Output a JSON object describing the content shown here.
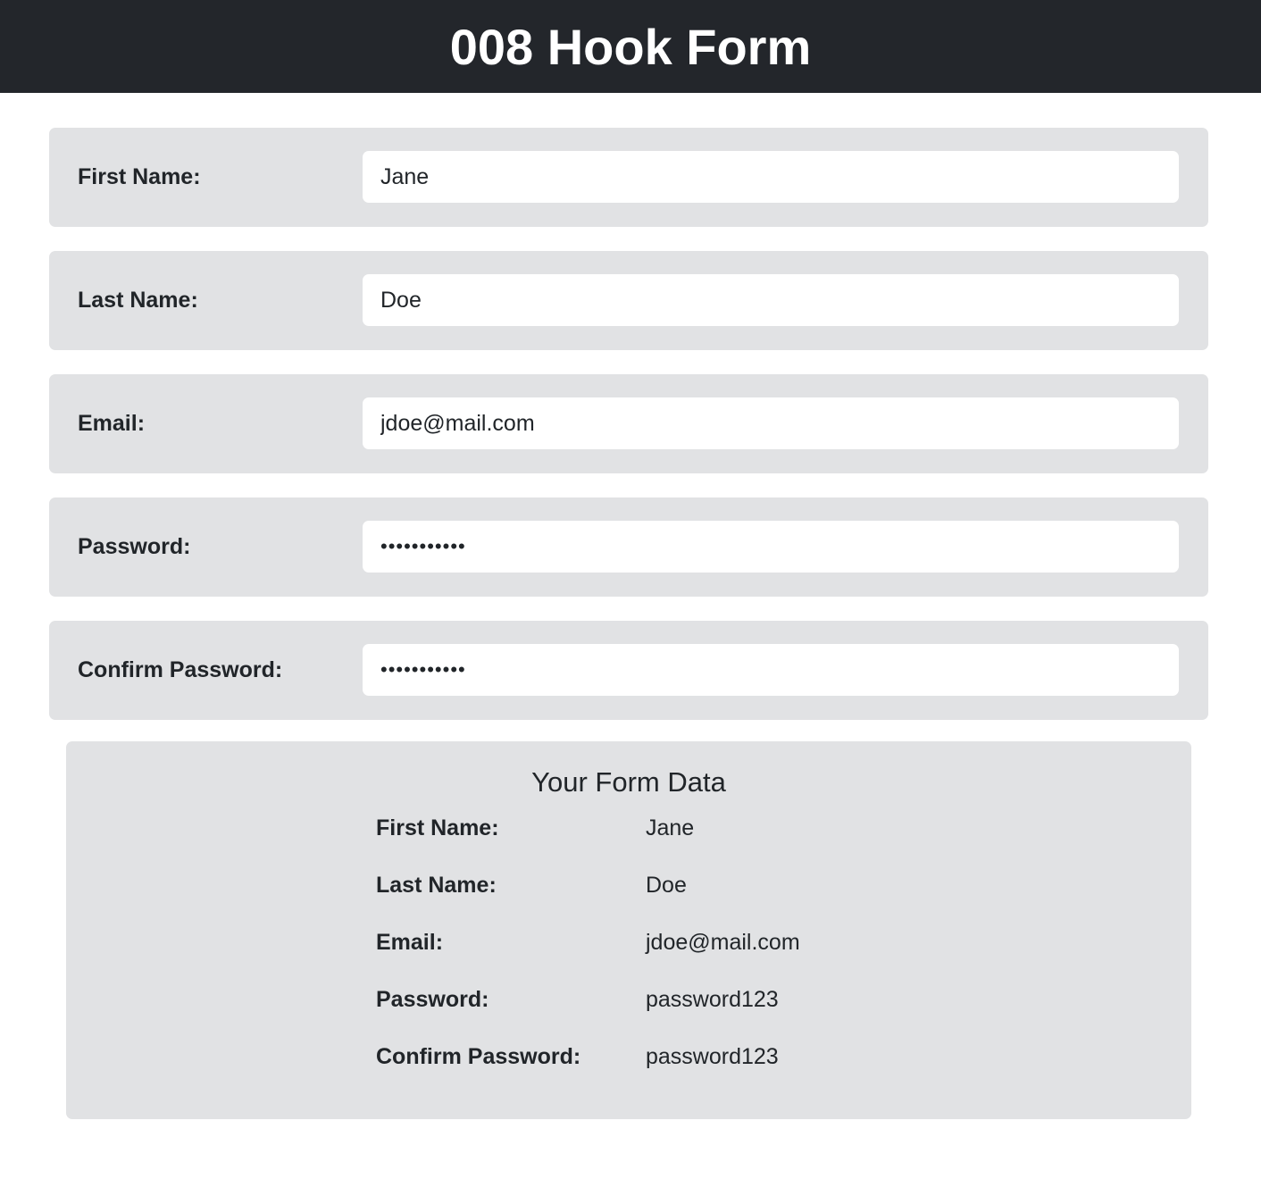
{
  "header": {
    "title": "008 Hook Form"
  },
  "form": {
    "fields": [
      {
        "label": "First Name:",
        "value": "Jane"
      },
      {
        "label": "Last Name:",
        "value": "Doe"
      },
      {
        "label": "Email:",
        "value": "jdoe@mail.com"
      },
      {
        "label": "Password:",
        "value": "password123"
      },
      {
        "label": "Confirm Password:",
        "value": "password123"
      }
    ]
  },
  "summary": {
    "title": "Your Form Data",
    "rows": [
      {
        "label": "First Name:",
        "value": "Jane"
      },
      {
        "label": "Last Name:",
        "value": "Doe"
      },
      {
        "label": "Email:",
        "value": "jdoe@mail.com"
      },
      {
        "label": "Password:",
        "value": "password123"
      },
      {
        "label": "Confirm Password:",
        "value": "password123"
      }
    ]
  }
}
